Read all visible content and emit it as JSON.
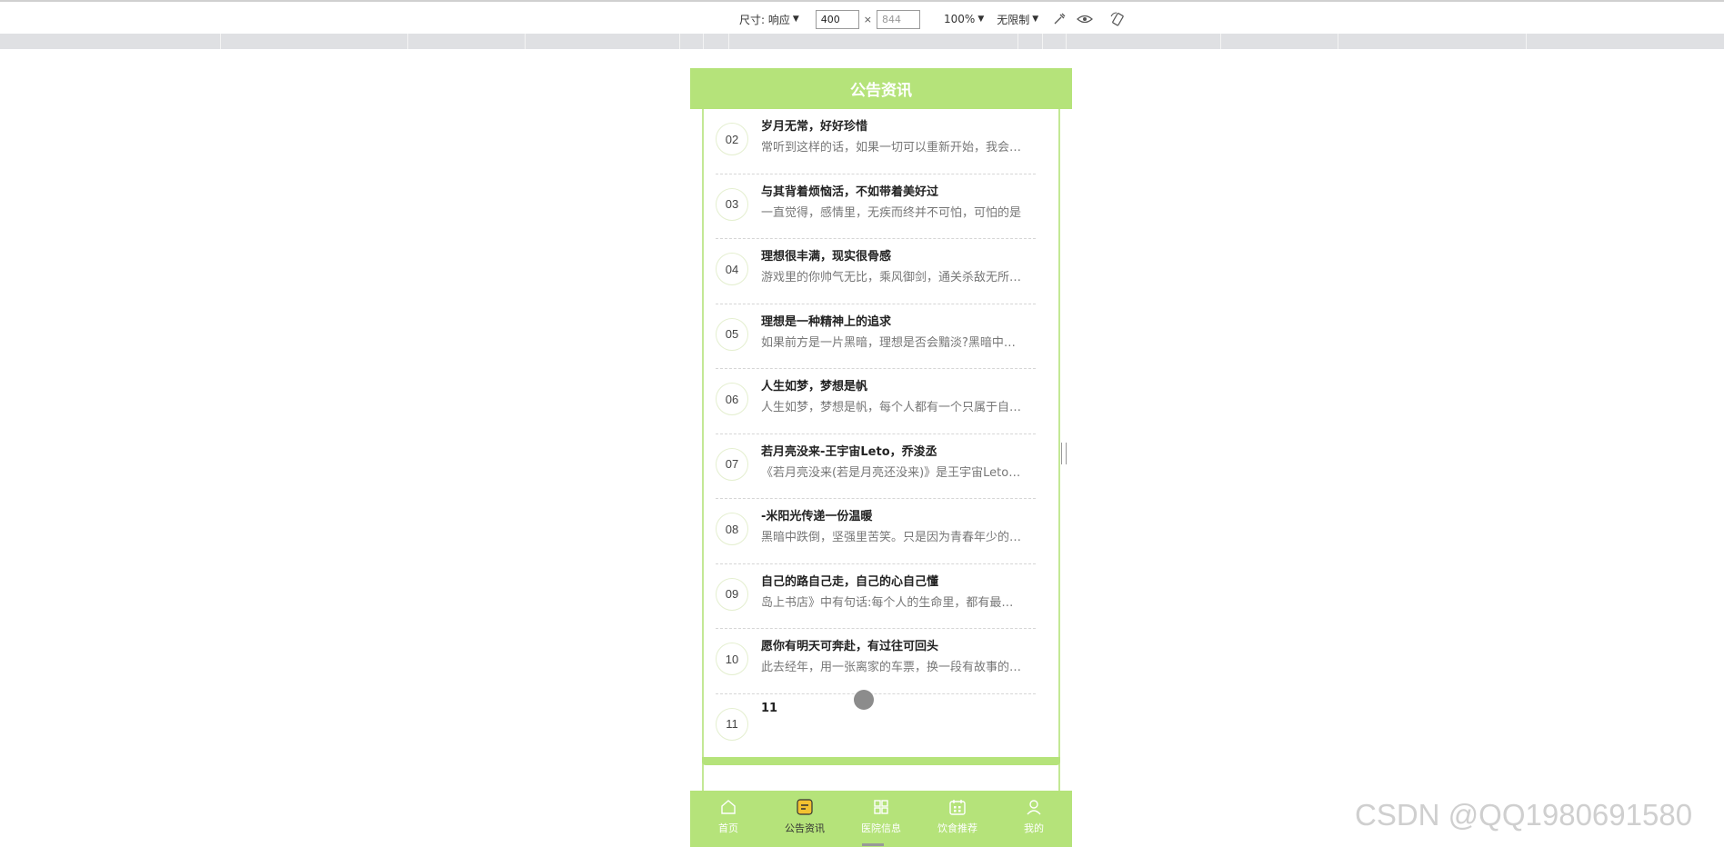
{
  "devtools": {
    "size_label": "尺寸: 响应",
    "width_value": "400",
    "height_placeholder": "844",
    "times": "×",
    "zoom_label": "100%",
    "throttle_label": "无限制"
  },
  "page": {
    "title": "公告资讯",
    "items": [
      {
        "num": "02",
        "title": "岁月无常，好好珍惜",
        "summary": "常听到这样的话，如果一切可以重新开始，我会如何如何"
      },
      {
        "num": "03",
        "title": "与其背着烦恼活，不如带着美好过",
        "summary": "一直觉得，感情里，无疾而终并不可怕，可怕的是"
      },
      {
        "num": "04",
        "title": "理想很丰满，现实很骨感",
        "summary": "游戏里的你帅气无比，乘风御剑，通关杀敌无所不能"
      },
      {
        "num": "05",
        "title": "理想是一种精神上的追求",
        "summary": "如果前方是一片黑暗，理想是否会黯淡?黑暗中的理想"
      },
      {
        "num": "06",
        "title": "人生如梦，梦想是帆",
        "summary": "人生如梦，梦想是帆，每个人都有一个只属于自己的梦"
      },
      {
        "num": "07",
        "title": "若月亮没来-王宇宙Leto，乔浚丞",
        "summary": "《若月亮没来(若是月亮还没来)》是王宇宙Leto的歌曲"
      },
      {
        "num": "08",
        "title": "-米阳光传递一份温暖",
        "summary": "黑暗中跌倒，坚强里苦笑。只是因为青春年少的我们"
      },
      {
        "num": "09",
        "title": "自己的路自己走，自己的心自己懂",
        "summary": "岛上书店》中有句话:每个人的生命里，都有最艰难的一年"
      },
      {
        "num": "10",
        "title": "愿你有明天可奔赴，有过往可回头",
        "summary": "此去经年，用一张离家的车票，换一段有故事的旅程"
      },
      {
        "num": "11",
        "title": "11",
        "summary": ""
      }
    ],
    "tabs": [
      {
        "label": "首页",
        "icon": "home-icon"
      },
      {
        "label": "公告资讯",
        "icon": "notice-icon"
      },
      {
        "label": "医院信息",
        "icon": "grid-icon"
      },
      {
        "label": "饮食推荐",
        "icon": "calendar-icon"
      },
      {
        "label": "我的",
        "icon": "user-icon"
      }
    ]
  },
  "watermark": "CSDN @QQ1980691580",
  "colors": {
    "accent": "#b5e37a"
  }
}
